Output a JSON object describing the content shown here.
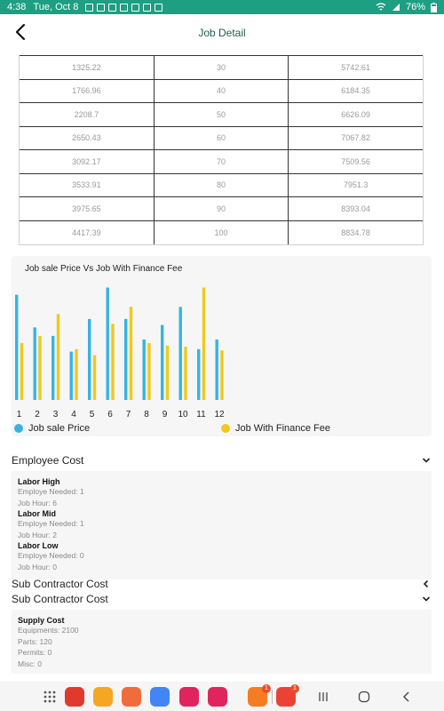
{
  "status_bar": {
    "time": "4:38",
    "date": "Tue, Oct 8",
    "battery": "76%",
    "color": "#1e9e83"
  },
  "app_bar": {
    "title": "Job Detail",
    "back_icon": "chevron-left-icon"
  },
  "table": {
    "rows": [
      [
        "1325.22",
        "30",
        "5742.61"
      ],
      [
        "1766.96",
        "40",
        "6184.35"
      ],
      [
        "2208.7",
        "50",
        "6626.09"
      ],
      [
        "2650.43",
        "60",
        "7067.82"
      ],
      [
        "3092.17",
        "70",
        "7509.56"
      ],
      [
        "3533.91",
        "80",
        "7951.3"
      ],
      [
        "3975.65",
        "90",
        "8393.04"
      ],
      [
        "4417.39",
        "100",
        "8834.78"
      ]
    ]
  },
  "chart_data": {
    "type": "bar",
    "title": "Job sale Price Vs Job With Finance Fee",
    "categories": [
      "1",
      "2",
      "3",
      "4",
      "5",
      "6",
      "7",
      "8",
      "9",
      "10",
      "11",
      "12"
    ],
    "series": [
      {
        "name": "Job sale Price",
        "color": "#35b4e4",
        "values": [
          87,
          60,
          53,
          40,
          67,
          93,
          67,
          50,
          62,
          77,
          42,
          50
        ]
      },
      {
        "name": "Job With Finance Fee",
        "color": "#f0c91c",
        "values": [
          47,
          53,
          71,
          42,
          37,
          63,
          77,
          47,
          45,
          44,
          93,
          41
        ]
      }
    ],
    "ylim": [
      0,
      100
    ],
    "legend_position": "bottom",
    "grid": false
  },
  "employee_cost": {
    "header": "Employee Cost",
    "groups": [
      {
        "title": "Labor High",
        "lines": [
          "Employe Needed: 1",
          "Job Hour: 6"
        ]
      },
      {
        "title": "Labor Mid",
        "lines": [
          "Employe Needed: 1",
          "Job Hour: 2"
        ]
      },
      {
        "title": "Labor Low",
        "lines": [
          "Employe Needed: 0",
          "Job Hour: 0"
        ]
      }
    ]
  },
  "sub_contractor_cost_1": {
    "header": "Sub Contractor Cost"
  },
  "sub_contractor_cost_2": {
    "header": "Sub Contractor Cost"
  },
  "supply_cost": {
    "title": "Supply Cost",
    "lines": [
      "Equipments: 2100",
      "Parts: 120",
      "Permits: 0",
      "Misc: 0"
    ]
  },
  "nav_bar": {
    "apps": [
      {
        "name": "apps-grid-icon",
        "color": "#555555"
      },
      {
        "name": "notes-app-icon",
        "color": "#e03a2f"
      },
      {
        "name": "files-app-icon",
        "color": "#f5a623"
      },
      {
        "name": "contacts-app-icon",
        "color": "#f26b3a"
      },
      {
        "name": "chrome-app-icon",
        "color": "#4285f4"
      },
      {
        "name": "flower-app-icon",
        "color": "#e0245e"
      },
      {
        "name": "camera-app-icon",
        "color": "#e0245e"
      },
      {
        "name": "tips-app-icon",
        "color": "#f57c1f",
        "badge": "1"
      },
      {
        "name": "gmail-app-icon",
        "color": "#ea4335",
        "badge": "1"
      }
    ]
  }
}
